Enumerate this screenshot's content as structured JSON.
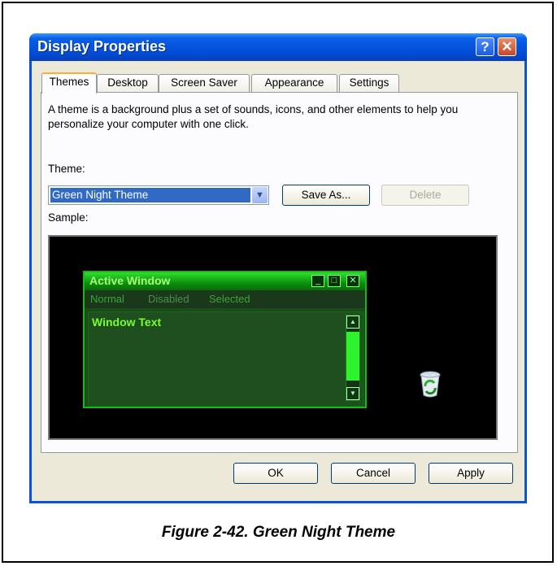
{
  "window": {
    "title": "Display Properties",
    "help_icon": "?",
    "close_icon": "✕"
  },
  "tabs": [
    {
      "label": "Themes",
      "active": true
    },
    {
      "label": "Desktop",
      "active": false
    },
    {
      "label": "Screen Saver",
      "active": false
    },
    {
      "label": "Appearance",
      "active": false
    },
    {
      "label": "Settings",
      "active": false
    }
  ],
  "themes_tab": {
    "description": "A theme is a background plus a set of sounds, icons, and other elements to help you personalize your computer with one click.",
    "theme_label": "Theme:",
    "theme_value": "Green Night Theme",
    "save_as": "Save As...",
    "delete": "Delete",
    "sample_label": "Sample:"
  },
  "sample": {
    "title": "Active Window",
    "menu_normal": "Normal",
    "menu_disabled": "Disabled",
    "menu_selected": "Selected",
    "window_text": "Window Text"
  },
  "footer": {
    "ok": "OK",
    "cancel": "Cancel",
    "apply": "Apply"
  },
  "caption": "Figure 2-42.  Green Night Theme",
  "colors": {
    "titlebar": "#0454df",
    "sample_title": "#2ee02e",
    "accent_tab": "#f8b135"
  }
}
